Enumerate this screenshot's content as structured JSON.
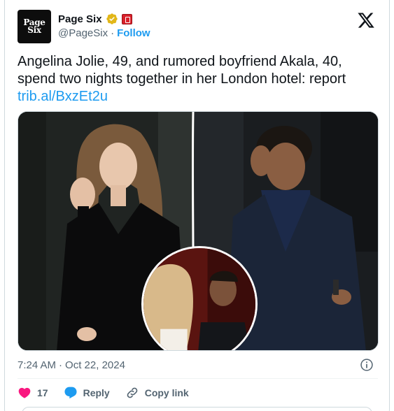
{
  "author": {
    "display_name": "Page Six",
    "handle": "@PageSix",
    "separator": "·",
    "follow_label": "Follow",
    "avatar_text": "Page Six"
  },
  "tweet": {
    "text": "Angelina Jolie, 49, and rumored boyfriend Akala, 40, spend two nights together in her London hotel: report",
    "link": "trib.al/BxzEt2u"
  },
  "meta": {
    "time": "7:24 AM",
    "separator": "·",
    "date": "Oct 22, 2024"
  },
  "actions": {
    "likes": "17",
    "reply_label": "Reply",
    "copy_link_label": "Copy link"
  },
  "colors": {
    "accent": "#1d9bf0",
    "like": "#f91880",
    "verified": "#e2b719",
    "text": "#0f1419",
    "muted": "#536471"
  },
  "icons": [
    "verified-badge-icon",
    "affiliate-badge-icon",
    "x-logo-icon",
    "info-icon",
    "heart-icon",
    "reply-icon",
    "link-icon"
  ]
}
